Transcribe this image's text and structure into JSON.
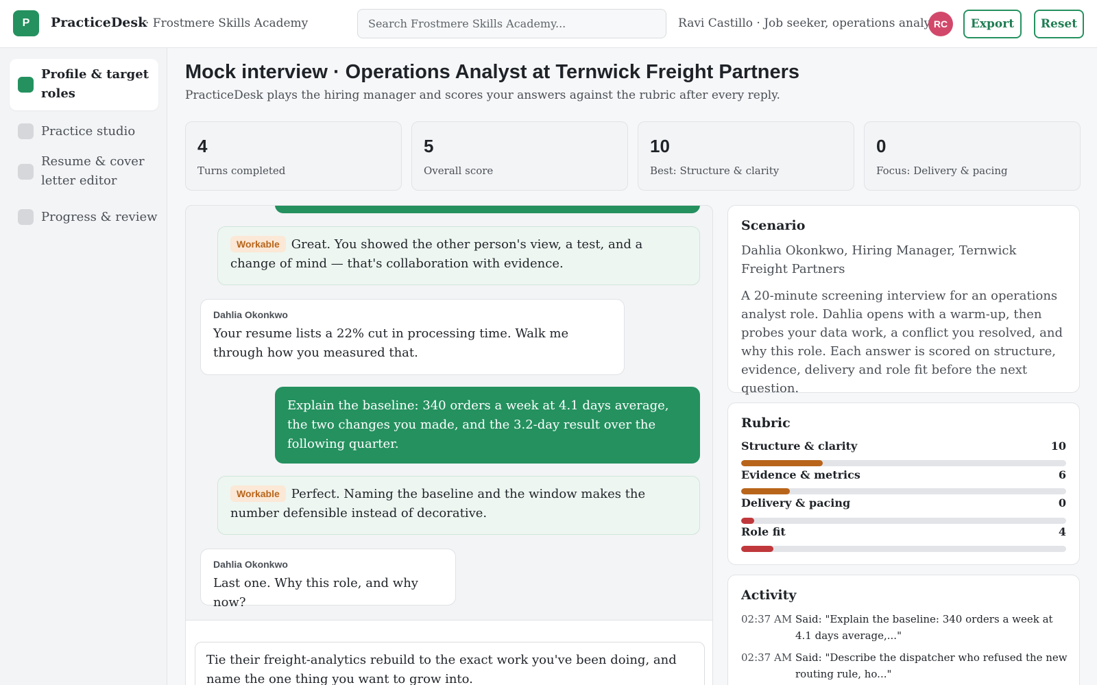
{
  "app": {
    "logo_letter": "P",
    "name": "PracticeDesk",
    "org": "· Frostmere Skills Academy",
    "search_placeholder": "Search Frostmere Skills Academy...",
    "user_label": "Ravi Castillo · Job seeker, operations analyst",
    "avatar_initials": "RC",
    "export_label": "Export",
    "reset_label": "Reset",
    "accent_color": "#24915f"
  },
  "sidebar": {
    "items": [
      {
        "label": "Profile & target roles",
        "active": true
      },
      {
        "label": "Practice studio",
        "active": false
      },
      {
        "label": "Resume & cover letter editor",
        "active": false
      },
      {
        "label": "Progress & review",
        "active": false
      }
    ]
  },
  "page": {
    "title": "Mock interview · Operations Analyst at Ternwick Freight Partners",
    "subtitle": "PracticeDesk plays the hiring manager and scores your answers against the rubric after every reply."
  },
  "stats": [
    {
      "value": "4",
      "label": "Turns completed"
    },
    {
      "value": "5",
      "label": "Overall score"
    },
    {
      "value": "10",
      "label": "Best: Structure & clarity"
    },
    {
      "value": "0",
      "label": "Focus: Delivery & pacing"
    }
  ],
  "chat": {
    "messages": [
      {
        "type": "feedback",
        "badge": "Workable",
        "text": "Great. You showed the other person's view, a test, and a change of mind — that's collaboration with evidence."
      },
      {
        "type": "manager",
        "speaker": "Dahlia Okonkwo",
        "text": "Your resume lists a 22% cut in processing time. Walk me through how you measured that."
      },
      {
        "type": "user",
        "text": "Explain the baseline: 340 orders a week at 4.1 days average, the two changes you made, and the 3.2-day result over the following quarter."
      },
      {
        "type": "feedback",
        "badge": "Workable",
        "text": "Perfect. Naming the baseline and the window makes the number defensible instead of decorative."
      },
      {
        "type": "manager",
        "speaker": "Dahlia Okonkwo",
        "text": "Last one. Why this role, and why now?"
      }
    ],
    "composer_value": "Tie their freight-analytics rebuild to the exact work you've been doing, and name the one thing you want to grow into."
  },
  "scenario": {
    "title": "Scenario",
    "who": "Dahlia Okonkwo, Hiring Manager, Ternwick Freight Partners",
    "description": "A 20-minute screening interview for an operations analyst role. Dahlia opens with a warm-up, then probes your data work, a conflict you resolved, and why this role. Each answer is scored on structure, evidence, delivery and role fit before the next question."
  },
  "rubric": {
    "title": "Rubric",
    "max": 40,
    "items": [
      {
        "name": "Structure & clarity",
        "score": "10",
        "fraction": 0.25,
        "color": "#b8651b"
      },
      {
        "name": "Evidence & metrics",
        "score": "6",
        "fraction": 0.15,
        "color": "#b8651b"
      },
      {
        "name": "Delivery & pacing",
        "score": "0",
        "fraction": 0.04,
        "color": "#c0383c"
      },
      {
        "name": "Role fit",
        "score": "4",
        "fraction": 0.1,
        "color": "#c0383c"
      }
    ]
  },
  "activity": {
    "title": "Activity",
    "items": [
      {
        "time": "02:37 AM",
        "text": "Said: \"Explain the baseline: 340 orders a week at 4.1 days average,...\""
      },
      {
        "time": "02:37 AM",
        "text": "Said: \"Describe the dispatcher who refused the new routing rule, ho...\""
      }
    ]
  }
}
